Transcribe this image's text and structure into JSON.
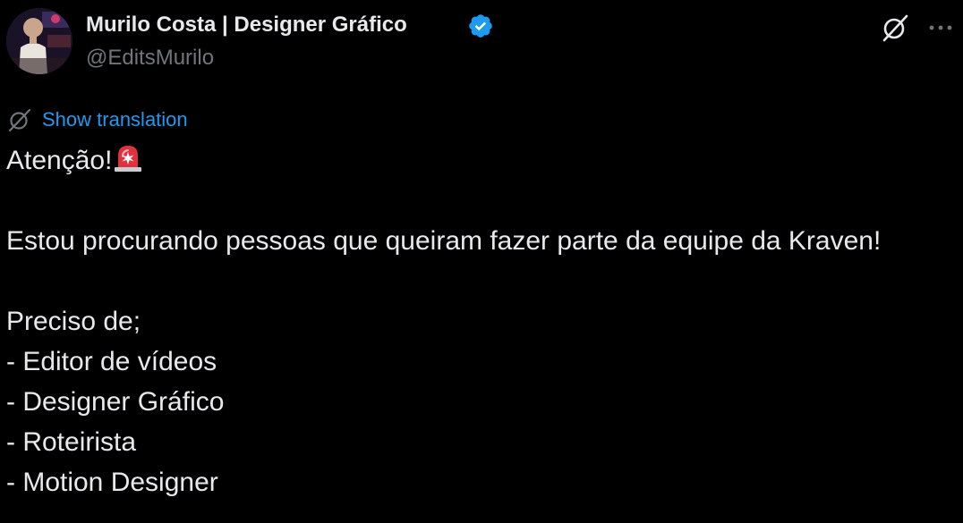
{
  "author": {
    "display_name": "Murilo Costa | Designer Gráfico",
    "handle": "@EditsMurilo",
    "verified": true,
    "avatar_icon": "avatar-photo"
  },
  "header_actions": {
    "grok_icon": "grok-icon",
    "more_icon": "more-icon"
  },
  "translate": {
    "label": "Show translation",
    "icon": "translate-icon"
  },
  "tweet": {
    "line1": "Atenção!",
    "line1_emoji": "siren-icon",
    "line2": "Estou procurando pessoas que queiram fazer parte da equipe da Kraven!",
    "line3": "Preciso de;",
    "items": [
      "- Editor de vídeos",
      "- Designer Gráfico",
      "- Roteirista",
      "- Motion Designer"
    ]
  },
  "colors": {
    "background": "#000000",
    "text": "#e7e9ea",
    "muted": "#71767b",
    "link": "#1d9bf0",
    "verified": "#1d9bf0"
  }
}
